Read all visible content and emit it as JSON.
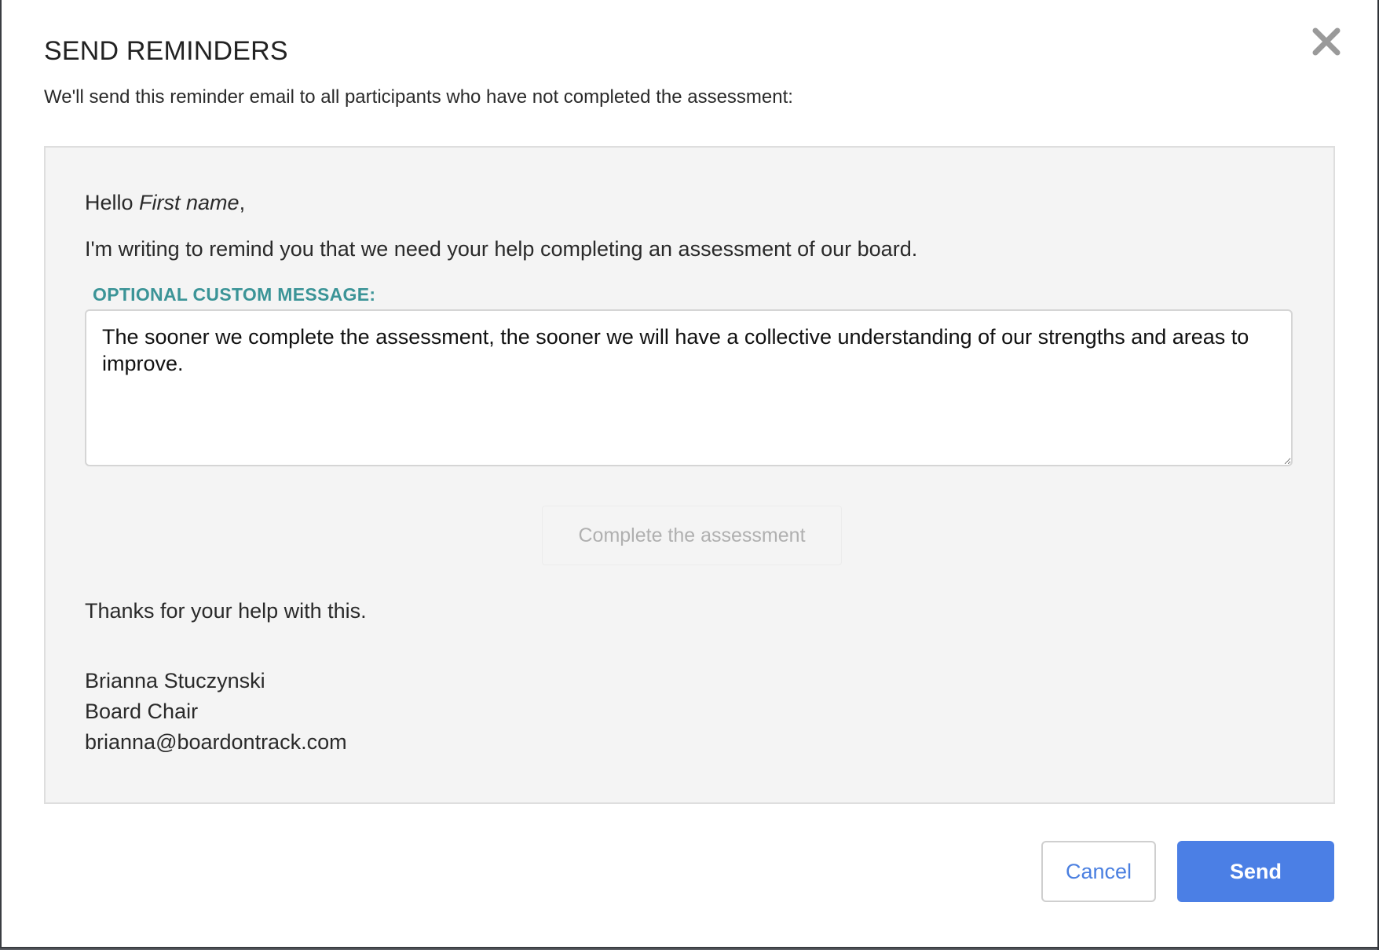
{
  "dialog": {
    "title": "SEND REMINDERS",
    "subtitle": "We'll send this reminder email to all participants who have not completed the assessment:",
    "close_icon": "close-icon"
  },
  "email": {
    "greeting_prefix": "Hello ",
    "greeting_name": "First name",
    "greeting_suffix": ",",
    "intro": "I'm writing to remind you that we need your help completing an assessment of our board.",
    "custom_message_label": "OPTIONAL CUSTOM MESSAGE:",
    "custom_message_value": "The sooner we complete the assessment, the sooner we will have a collective understanding of our strengths and areas to improve.",
    "cta_label": "Complete the assessment",
    "thanks": "Thanks for your help with this.",
    "signature": {
      "name": "Brianna Stuczynski",
      "role": "Board Chair",
      "email": "brianna@boardontrack.com"
    }
  },
  "actions": {
    "cancel_label": "Cancel",
    "send_label": "Send"
  },
  "colors": {
    "accent_blue": "#4b7fe5",
    "label_teal": "#3b9497",
    "preview_bg": "#f4f4f4"
  }
}
